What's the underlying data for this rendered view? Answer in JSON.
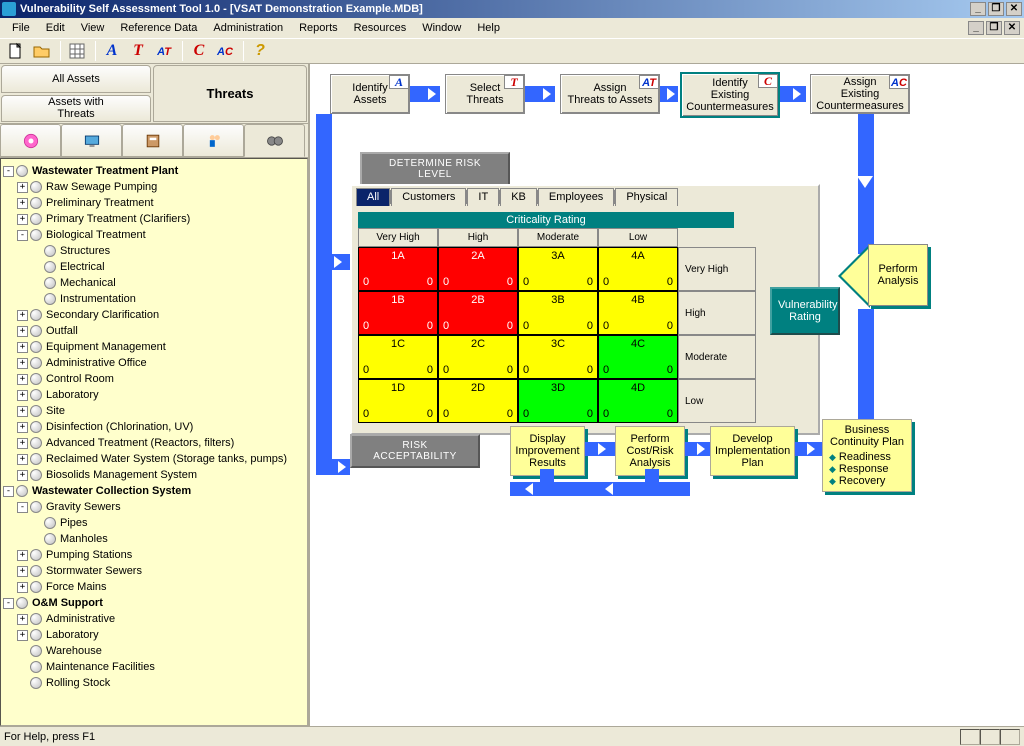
{
  "title": "Vulnerability Self Assessment Tool 1.0 - [VSAT Demonstration Example.MDB]",
  "menu": [
    "File",
    "Edit",
    "View",
    "Reference Data",
    "Administration",
    "Reports",
    "Resources",
    "Window",
    "Help"
  ],
  "tabs": {
    "all_assets": "All Assets",
    "assets_with_threats": "Assets with\nThreats",
    "threats": "Threats"
  },
  "tree": [
    {
      "l": 0,
      "e": "-",
      "b": true,
      "t": "Wastewater Treatment Plant"
    },
    {
      "l": 1,
      "e": "+",
      "t": "Raw Sewage Pumping"
    },
    {
      "l": 1,
      "e": "+",
      "t": "Preliminary Treatment"
    },
    {
      "l": 1,
      "e": "+",
      "t": "Primary Treatment (Clarifiers)"
    },
    {
      "l": 1,
      "e": "-",
      "t": "Biological Treatment"
    },
    {
      "l": 2,
      "e": " ",
      "t": "Structures"
    },
    {
      "l": 2,
      "e": " ",
      "t": "Electrical"
    },
    {
      "l": 2,
      "e": " ",
      "t": "Mechanical"
    },
    {
      "l": 2,
      "e": " ",
      "t": "Instrumentation"
    },
    {
      "l": 1,
      "e": "+",
      "t": "Secondary Clarification"
    },
    {
      "l": 1,
      "e": "+",
      "t": "Outfall"
    },
    {
      "l": 1,
      "e": "+",
      "t": "Equipment Management"
    },
    {
      "l": 1,
      "e": "+",
      "t": "Administrative Office"
    },
    {
      "l": 1,
      "e": "+",
      "t": "Control Room"
    },
    {
      "l": 1,
      "e": "+",
      "t": "Laboratory"
    },
    {
      "l": 1,
      "e": "+",
      "t": "Site"
    },
    {
      "l": 1,
      "e": "+",
      "t": "Disinfection (Chlorination, UV)"
    },
    {
      "l": 1,
      "e": "+",
      "t": "Advanced Treatment (Reactors, filters)"
    },
    {
      "l": 1,
      "e": "+",
      "t": "Reclaimed Water System (Storage tanks, pumps)"
    },
    {
      "l": 1,
      "e": "+",
      "t": "Biosolids Management System"
    },
    {
      "l": 0,
      "e": "-",
      "b": true,
      "t": "Wastewater Collection System"
    },
    {
      "l": 1,
      "e": "-",
      "t": "Gravity Sewers"
    },
    {
      "l": 2,
      "e": " ",
      "t": "Pipes"
    },
    {
      "l": 2,
      "e": " ",
      "t": "Manholes"
    },
    {
      "l": 1,
      "e": "+",
      "t": "Pumping Stations"
    },
    {
      "l": 1,
      "e": "+",
      "t": "Stormwater Sewers"
    },
    {
      "l": 1,
      "e": "+",
      "t": "Force Mains"
    },
    {
      "l": 0,
      "e": "-",
      "b": true,
      "t": "O&M Support"
    },
    {
      "l": 1,
      "e": "+",
      "t": "Administrative"
    },
    {
      "l": 1,
      "e": "+",
      "t": "Laboratory"
    },
    {
      "l": 1,
      "e": " ",
      "t": "Warehouse"
    },
    {
      "l": 1,
      "e": " ",
      "t": "Maintenance Facilities"
    },
    {
      "l": 1,
      "e": " ",
      "t": "Rolling Stock"
    }
  ],
  "workflow": {
    "identify_assets": "Identify\nAssets",
    "select_threats": "Select\nThreats",
    "assign_threats": "Assign\nThreats to Assets",
    "identify_cm": "Identify\nExisting\nCountermeasures",
    "assign_cm": "Assign\nExisting\nCountermeasures"
  },
  "buttons": {
    "determine_risk": "DETERMINE RISK LEVEL",
    "risk_accept": "RISK ACCEPTABILITY"
  },
  "matrix": {
    "tabs": [
      "All",
      "Customers",
      "IT",
      "KB",
      "Employees",
      "Physical"
    ],
    "header": "Criticality Rating",
    "cols": [
      "Very High",
      "High",
      "Moderate",
      "Low"
    ],
    "rows": [
      "Very High",
      "High",
      "Moderate",
      "Low"
    ],
    "cells": [
      [
        {
          "id": "1A",
          "n": "0",
          "c": "red"
        },
        {
          "id": "2A",
          "n": "0",
          "c": "red"
        },
        {
          "id": "3A",
          "n": "0",
          "c": "yel"
        },
        {
          "id": "4A",
          "n": "0",
          "c": "yel"
        }
      ],
      [
        {
          "id": "1B",
          "n": "0",
          "c": "red"
        },
        {
          "id": "2B",
          "n": "0",
          "c": "red"
        },
        {
          "id": "3B",
          "n": "0",
          "c": "yel"
        },
        {
          "id": "4B",
          "n": "0",
          "c": "yel"
        }
      ],
      [
        {
          "id": "1C",
          "n": "0",
          "c": "yel"
        },
        {
          "id": "2C",
          "n": "0",
          "c": "yel"
        },
        {
          "id": "3C",
          "n": "0",
          "c": "yel"
        },
        {
          "id": "4C",
          "n": "0",
          "c": "grn"
        }
      ],
      [
        {
          "id": "1D",
          "n": "0",
          "c": "yel"
        },
        {
          "id": "2D",
          "n": "0",
          "c": "yel"
        },
        {
          "id": "3D",
          "n": "0",
          "c": "grn"
        },
        {
          "id": "4D",
          "n": "0",
          "c": "grn"
        }
      ]
    ],
    "zeros_left": "0"
  },
  "vuln_rating": "Vulnerability\nRating",
  "perform_analysis": "Perform\nAnalysis",
  "bottom_flow": {
    "display_results": "Display\nImprovement\nResults",
    "cost_risk": "Perform\nCost/Risk\nAnalysis",
    "develop_plan": "Develop\nImplementation\nPlan",
    "bcp_title": "Business\nContinuity Plan",
    "bcp_items": [
      "Readiness",
      "Response",
      "Recovery"
    ]
  },
  "status": "For Help, press F1",
  "chart_data": {
    "type": "heatmap",
    "title": "Criticality Rating vs Vulnerability Rating Risk Matrix",
    "xlabel": "Criticality Rating",
    "ylabel": "Vulnerability Rating",
    "x_categories": [
      "Very High",
      "High",
      "Moderate",
      "Low"
    ],
    "y_categories": [
      "Very High",
      "High",
      "Moderate",
      "Low"
    ],
    "cell_labels": [
      [
        "1A",
        "2A",
        "3A",
        "4A"
      ],
      [
        "1B",
        "2B",
        "3B",
        "4B"
      ],
      [
        "1C",
        "2C",
        "3C",
        "4C"
      ],
      [
        "1D",
        "2D",
        "3D",
        "4D"
      ]
    ],
    "counts": [
      [
        0,
        0,
        0,
        0
      ],
      [
        0,
        0,
        0,
        0
      ],
      [
        0,
        0,
        0,
        0
      ],
      [
        0,
        0,
        0,
        0
      ]
    ],
    "risk_level": [
      [
        "High",
        "High",
        "Medium",
        "Medium"
      ],
      [
        "High",
        "High",
        "Medium",
        "Medium"
      ],
      [
        "Medium",
        "Medium",
        "Medium",
        "Low"
      ],
      [
        "Medium",
        "Medium",
        "Low",
        "Low"
      ]
    ],
    "legend": {
      "High": "#ff0000",
      "Medium": "#ffff00",
      "Low": "#00ff00"
    }
  }
}
